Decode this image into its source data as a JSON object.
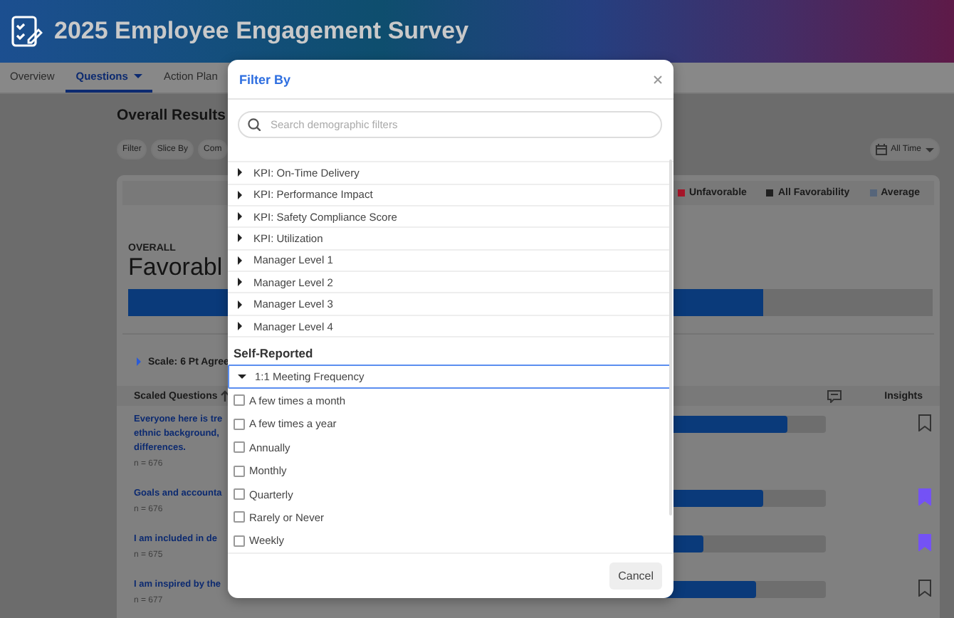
{
  "header": {
    "title": "2025 Employee Engagement Survey"
  },
  "tabs": [
    {
      "label": "Overview",
      "selected": false,
      "dropdown": false
    },
    {
      "label": "Questions",
      "selected": true,
      "dropdown": true
    },
    {
      "label": "Action Plan",
      "selected": false,
      "dropdown": false
    }
  ],
  "results": {
    "title": "Overall Results",
    "chips": [
      "Filter",
      "Slice By",
      "Com"
    ],
    "date_range": "All Time",
    "legend": [
      {
        "label": "Unfavorable",
        "color": "#a8162a"
      },
      {
        "label": "All Favorability",
        "color": "#202020"
      },
      {
        "label": "Average",
        "color": "#56657a"
      }
    ],
    "overall": {
      "label": "OVERALL",
      "value": "Favorabl",
      "level": 0.79
    },
    "scale": "Scale: 6 Pt Agree",
    "table": {
      "column_1": "Scaled Questions",
      "column_3": "Insights",
      "rows": [
        {
          "question": [
            "Everyone here is tre",
            "ethnic background,",
            "differences."
          ],
          "n": "n = 676",
          "level": 0.89,
          "bookmarked": false
        },
        {
          "question": [
            "Goals and accounta"
          ],
          "n": "n = 676",
          "level": 0.82,
          "bookmarked": true
        },
        {
          "question": [
            "I am included in de"
          ],
          "n": "n = 675",
          "level": 0.65,
          "bookmarked": true
        },
        {
          "question": [
            "I am inspired by the"
          ],
          "n": "n = 677",
          "level": 0.8,
          "bookmarked": false
        }
      ]
    }
  },
  "filter_modal": {
    "title": "Filter By",
    "search": {
      "placeholder": "Search demographic filters"
    },
    "sections": [
      {
        "groups": [
          {
            "label": "KPI: On-Time Delivery",
            "expanded": false,
            "focused": false
          },
          {
            "label": "KPI: Performance Impact",
            "expanded": false,
            "focused": false
          },
          {
            "label": "KPI: Safety Compliance Score",
            "expanded": false,
            "focused": false
          },
          {
            "label": "KPI: Utilization",
            "expanded": false,
            "focused": false
          },
          {
            "label": "Manager Level 1",
            "expanded": false,
            "focused": false
          },
          {
            "label": "Manager Level 2",
            "expanded": false,
            "focused": false
          },
          {
            "label": "Manager Level 3",
            "expanded": false,
            "focused": false
          },
          {
            "label": "Manager Level 4",
            "expanded": false,
            "focused": false
          }
        ]
      },
      {
        "heading": "Self-Reported",
        "groups": [
          {
            "label": "1:1 Meeting Frequency",
            "expanded": true,
            "focused": true,
            "children": [
              {
                "label": "A few times a month",
                "checked": false
              },
              {
                "label": "A few times a year",
                "checked": false
              },
              {
                "label": "Annually",
                "checked": false
              },
              {
                "label": "Monthly",
                "checked": false
              },
              {
                "label": "Quarterly",
                "checked": false
              },
              {
                "label": "Rarely or Never",
                "checked": false
              },
              {
                "label": "Weekly",
                "checked": false
              }
            ]
          }
        ]
      }
    ],
    "buttons": [
      "Cancel"
    ]
  }
}
